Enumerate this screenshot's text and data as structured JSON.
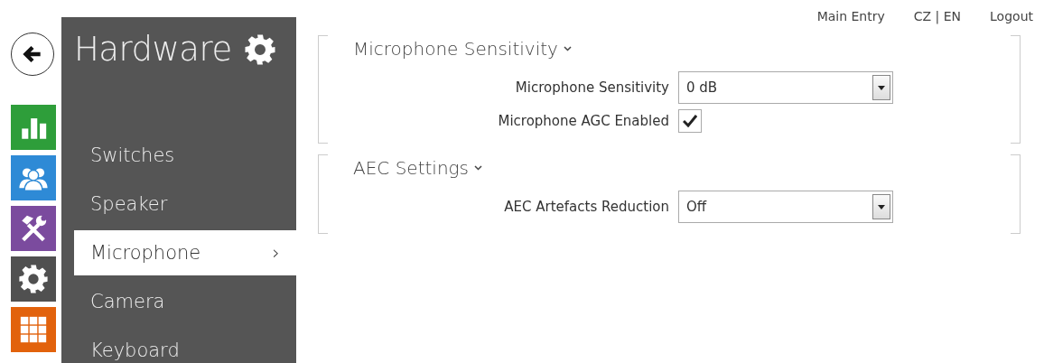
{
  "top_links": [
    "Main Entry",
    "CZ | EN",
    "Logout"
  ],
  "app_icons": [
    {
      "kind": "stats",
      "color": "#2e9e3a"
    },
    {
      "kind": "users",
      "color": "#2e8ad6"
    },
    {
      "kind": "tools",
      "color": "#7b4b9e"
    },
    {
      "kind": "gear",
      "color": "#505050"
    },
    {
      "kind": "grid",
      "color": "#e2620c"
    }
  ],
  "sidebar": {
    "title": "Hardware",
    "items": [
      {
        "label": "Switches",
        "selected": false
      },
      {
        "label": "Speaker",
        "selected": false
      },
      {
        "label": "Microphone",
        "selected": true,
        "arrow": "›"
      },
      {
        "label": "Camera",
        "selected": false
      },
      {
        "label": "Keyboard",
        "selected": false
      }
    ]
  },
  "sections": [
    {
      "title": "Microphone Sensitivity",
      "expanded": true,
      "fields": [
        {
          "kind": "select",
          "label": "Microphone Sensitivity",
          "value": "0 dB"
        },
        {
          "kind": "checkbox",
          "label": "Microphone AGC Enabled",
          "checked": true
        }
      ]
    },
    {
      "title": "AEC Settings",
      "expanded": true,
      "fields": [
        {
          "kind": "select",
          "label": "AEC Artefacts Reduction",
          "value": "Off"
        }
      ]
    }
  ]
}
